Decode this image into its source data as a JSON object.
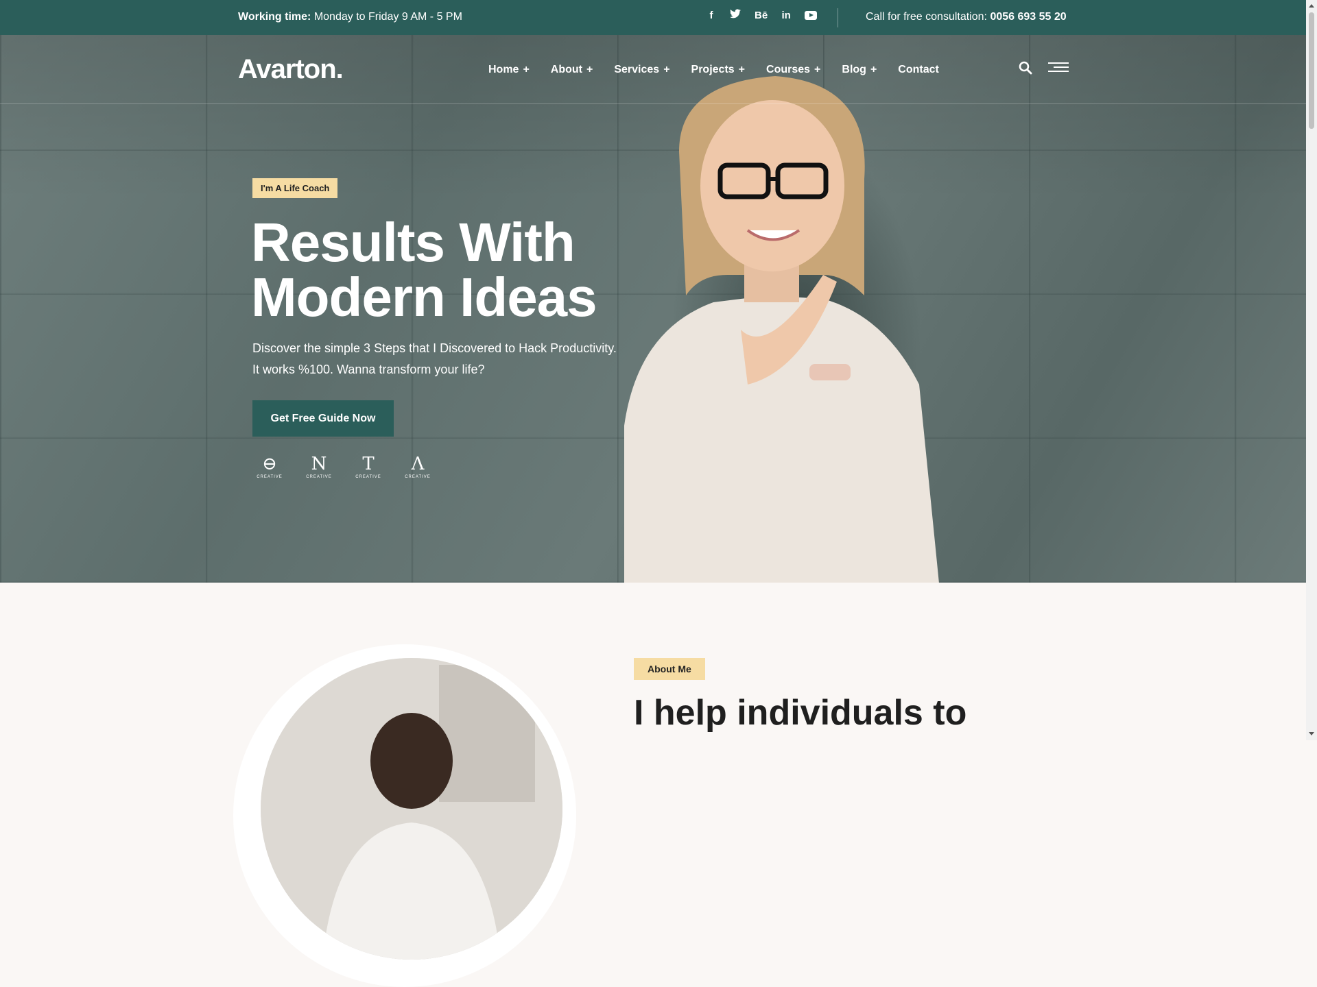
{
  "topbar": {
    "working_label": "Working time:",
    "working_value": "Monday to Friday 9 AM - 5 PM",
    "social": [
      "f",
      "t",
      "Bē",
      "in",
      "yt"
    ],
    "call_label": "Call for free consultation:",
    "call_value": "0056 693 55 20"
  },
  "header": {
    "logo": "Avarton.",
    "nav": [
      {
        "label": "Home",
        "has_sub": true
      },
      {
        "label": "About",
        "has_sub": true
      },
      {
        "label": "Services",
        "has_sub": true
      },
      {
        "label": "Projects",
        "has_sub": true
      },
      {
        "label": "Courses",
        "has_sub": true
      },
      {
        "label": "Blog",
        "has_sub": true
      },
      {
        "label": "Contact",
        "has_sub": false
      }
    ],
    "plus": "+"
  },
  "hero": {
    "badge": "I'm A Life Coach",
    "headline_line1": "Results With",
    "headline_line2": "Modern Ideas",
    "desc_line1": "Discover the simple 3 Steps that I Discovered to Hack Productivity.",
    "desc_line2": "It works %100. Wanna transform your life?",
    "cta": "Get Free Guide Now",
    "brands": [
      {
        "glyph": "⊖",
        "text": "CREATIVE"
      },
      {
        "glyph": "N",
        "text": "CREATIVE"
      },
      {
        "glyph": "T",
        "text": "CREATIVE"
      },
      {
        "glyph": "Λ",
        "text": "CREATIVE"
      }
    ]
  },
  "about": {
    "badge": "About Me",
    "title": "I help individuals to"
  },
  "colors": {
    "brand": "#2b5e5a",
    "accent": "#f6dca3",
    "page_bg": "#faf7f5"
  }
}
